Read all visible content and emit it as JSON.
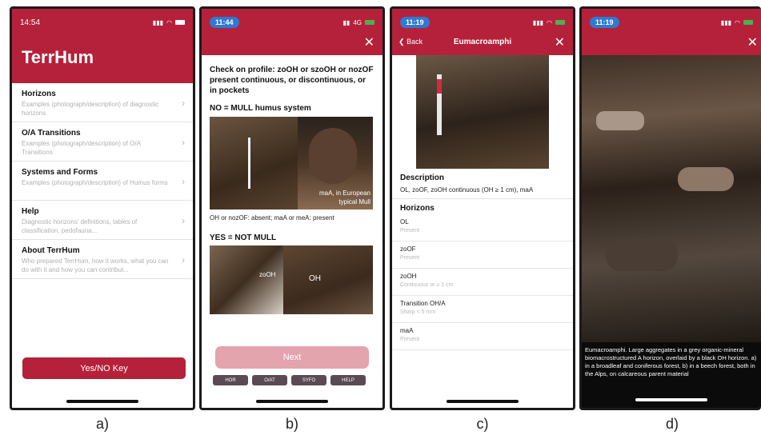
{
  "panel_a": {
    "time": "14:54",
    "app_title": "TerrHum",
    "items": [
      {
        "title": "Horizons",
        "sub": "Examples (photograph/description) of diagnostic horizons"
      },
      {
        "title": "O/A Transitions",
        "sub": "Examples (photograph/description) of O/A Transitions"
      },
      {
        "title": "Systems and Forms",
        "sub": "Examples (photograph/description) of Humus forms"
      },
      {
        "title": "Help",
        "sub": "Diagnostic horizons' definitions, tables of classification, pedofauna..."
      },
      {
        "title": "About TerrHum",
        "sub": "Who prepared TerrHum, how it works, what you can do with it and how you can contribut..."
      }
    ],
    "button": "Yes/NO Key",
    "caption": "a)"
  },
  "panel_b": {
    "time": "11:44",
    "network": "4G",
    "question": "Check on profile: zoOH or szoOH or nozOF present continuous, or discontinuous, or in pockets",
    "no_title": "NO = MULL humus system",
    "photo_label_1": "maA, in European typical Mull",
    "no_text": "OH or nozOF: absent; maA or meA: present",
    "yes_title": "YES = NOT MULL",
    "photo_label_2": "zoOH",
    "photo_label_3": "OH",
    "next": "Next",
    "tabs": [
      "HOR",
      "O/AT",
      "SYFO",
      "HELP"
    ],
    "caption": "b)"
  },
  "panel_c": {
    "time": "11:19",
    "back": "Back",
    "title": "Eumacroamphi",
    "description_label": "Description",
    "description": "OL, zoOF, zoOH continuous (OH ≥ 1 cm), maA",
    "horizons_label": "Horizons",
    "horizons": [
      {
        "name": "OL",
        "value": "Present"
      },
      {
        "name": "zoOF",
        "value": "Present"
      },
      {
        "name": "zoOH",
        "value": "Continuous or ≥ 1 cm"
      },
      {
        "name": "Transition OH/A",
        "value": "Sharp < 5 mm"
      },
      {
        "name": "maA",
        "value": "Present"
      }
    ],
    "caption": "c)"
  },
  "panel_d": {
    "time": "11:19",
    "photo_caption": "Eumacroamphi. Large aggregates in a grey organic-mineral biomacrostructured A horizon, overlaid by a black OH horizon. a) in a broadleaf and coniferous forest, b) in a beech forest, both in the Alps, on calcareous parent material",
    "caption": "d)"
  },
  "colors": {
    "header": "#b5213a",
    "next_button": "#e3a4ae",
    "tab": "#5b4a54",
    "time_pill": "#2f7ad0"
  }
}
